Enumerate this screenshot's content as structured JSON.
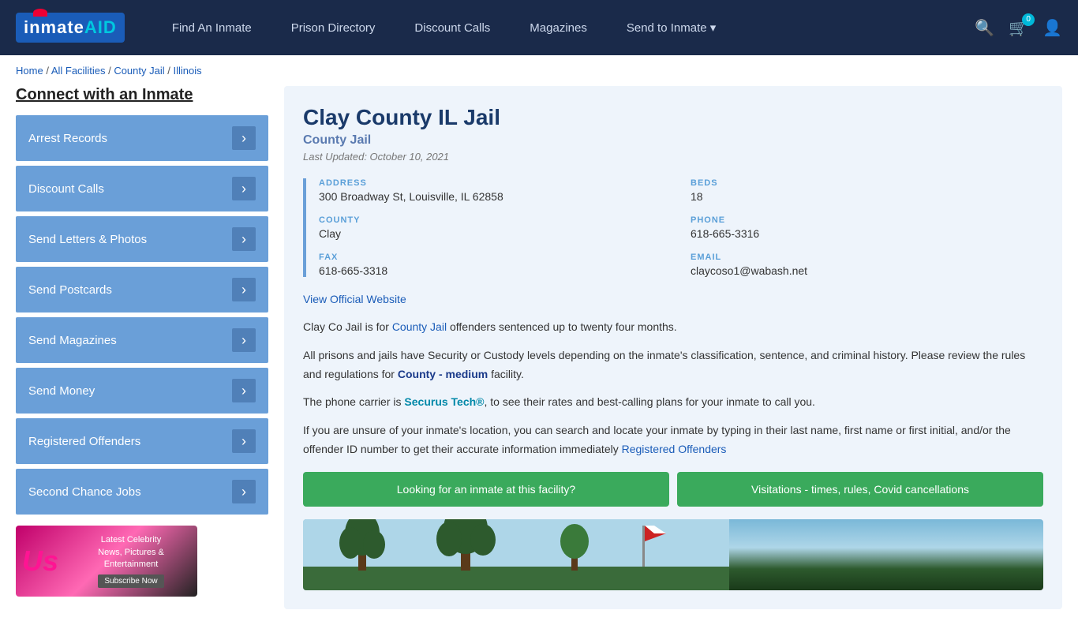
{
  "nav": {
    "logo_text": "inmate AID",
    "links": [
      {
        "label": "Find An Inmate",
        "id": "find-inmate"
      },
      {
        "label": "Prison Directory",
        "id": "prison-directory"
      },
      {
        "label": "Discount Calls",
        "id": "discount-calls"
      },
      {
        "label": "Magazines",
        "id": "magazines"
      },
      {
        "label": "Send to Inmate ▾",
        "id": "send-to-inmate"
      }
    ],
    "cart_count": "0"
  },
  "breadcrumb": {
    "home": "Home",
    "all_facilities": "All Facilities",
    "county_jail": "County Jail",
    "state": "Illinois"
  },
  "sidebar": {
    "title": "Connect with an Inmate",
    "items": [
      {
        "label": "Arrest Records",
        "id": "arrest-records"
      },
      {
        "label": "Discount Calls",
        "id": "discount-calls"
      },
      {
        "label": "Send Letters & Photos",
        "id": "send-letters"
      },
      {
        "label": "Send Postcards",
        "id": "send-postcards"
      },
      {
        "label": "Send Magazines",
        "id": "send-magazines"
      },
      {
        "label": "Send Money",
        "id": "send-money"
      },
      {
        "label": "Registered Offenders",
        "id": "registered-offenders"
      },
      {
        "label": "Second Chance Jobs",
        "id": "second-chance-jobs"
      }
    ],
    "ad": {
      "logo": "Us",
      "line1": "Latest Celebrity",
      "line2": "News, Pictures &",
      "line3": "Entertainment",
      "button": "Subscribe Now"
    }
  },
  "facility": {
    "title": "Clay County IL Jail",
    "subtitle": "County Jail",
    "updated": "Last Updated: October 10, 2021",
    "address_label": "ADDRESS",
    "address_value": "300 Broadway St, Louisville, IL 62858",
    "beds_label": "BEDS",
    "beds_value": "18",
    "county_label": "COUNTY",
    "county_value": "Clay",
    "phone_label": "PHONE",
    "phone_value": "618-665-3316",
    "fax_label": "FAX",
    "fax_value": "618-665-3318",
    "email_label": "EMAIL",
    "email_value": "claycoso1@wabash.net",
    "website_link": "View Official Website",
    "desc1": "Clay Co Jail is for County Jail offenders sentenced up to twenty four months.",
    "desc2": "All prisons and jails have Security or Custody levels depending on the inmate's classification, sentence, and criminal history. Please review the rules and regulations for County - medium facility.",
    "desc3": "The phone carrier is Securus Tech®, to see their rates and best-calling plans for your inmate to call you.",
    "desc4": "If you are unsure of your inmate's location, you can search and locate your inmate by typing in their last name, first name or first initial, and/or the offender ID number to get their accurate information immediately Registered Offenders",
    "btn1": "Looking for an inmate at this facility?",
    "btn2": "Visitations - times, rules, Covid cancellations"
  }
}
